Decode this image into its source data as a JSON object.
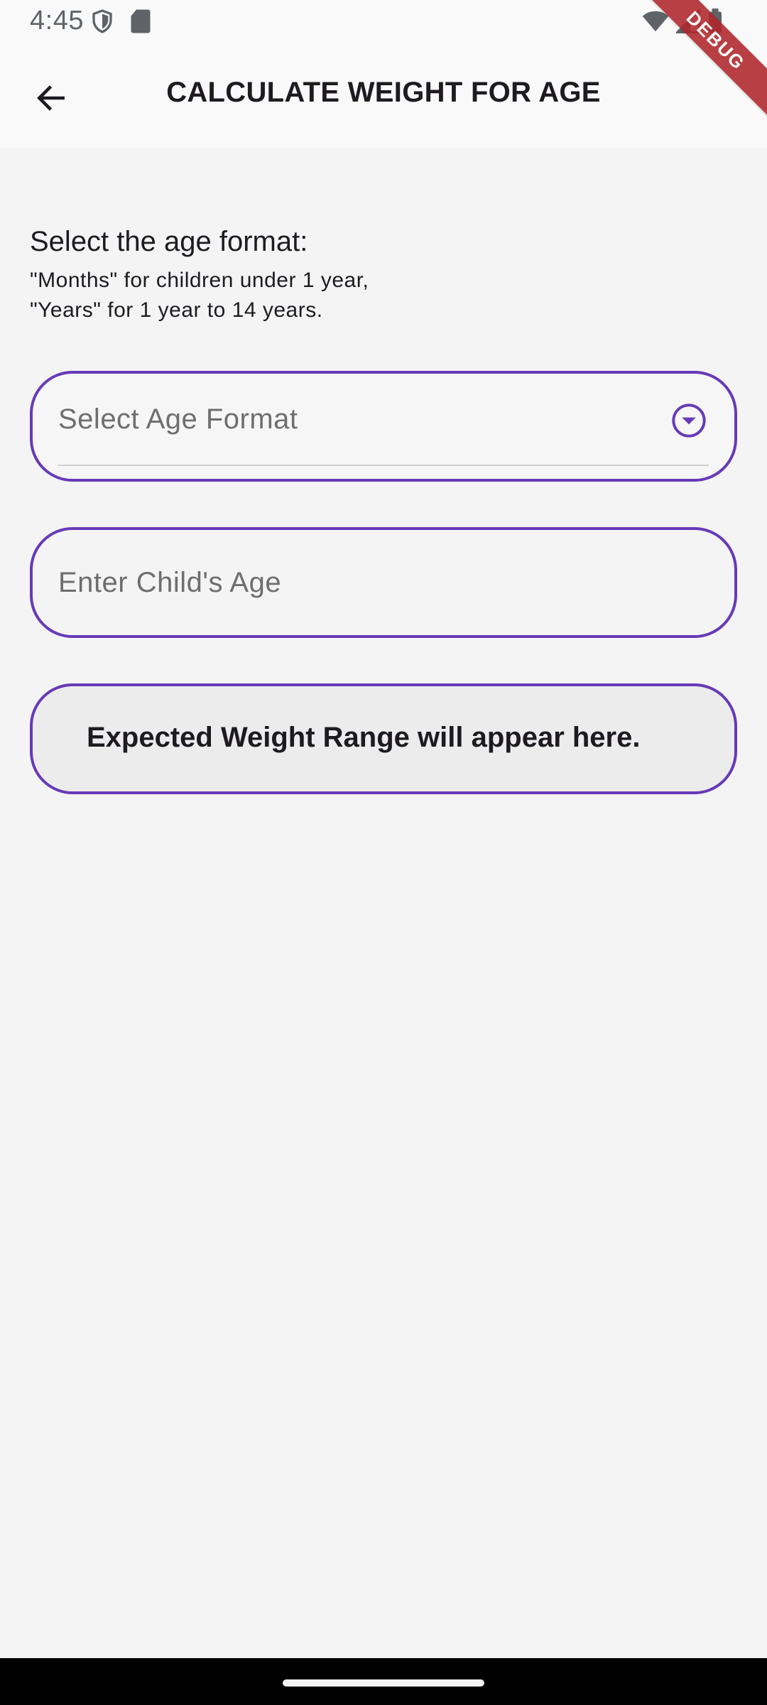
{
  "status_bar": {
    "time": "4:45",
    "icons_left": [
      "shield-icon",
      "sd-card-icon"
    ],
    "icons_right": [
      "wifi-icon",
      "signal-icon",
      "battery-icon"
    ]
  },
  "debug_banner": "DEBUG",
  "app_bar": {
    "back_icon": "arrow-back-icon",
    "title": "CALCULATE WEIGHT FOR AGE"
  },
  "instructions": {
    "heading": "Select the age format:",
    "line1": "\"Months\" for children under 1 year,",
    "line2": "\"Years\" for 1 year to 14 years."
  },
  "dropdown": {
    "placeholder": "Select Age Format",
    "icon": "arrow-drop-down-circle-icon"
  },
  "age_input": {
    "placeholder": "Enter Child's Age"
  },
  "result": {
    "text": "Expected Weight Range will appear here."
  },
  "colors": {
    "accent": "#673ab7",
    "background": "#f4f4f4",
    "app_bar": "#f9f9f9",
    "placeholder_text": "#6e6e6e",
    "result_background": "#ececec",
    "debug_banner": "#b0262b"
  }
}
